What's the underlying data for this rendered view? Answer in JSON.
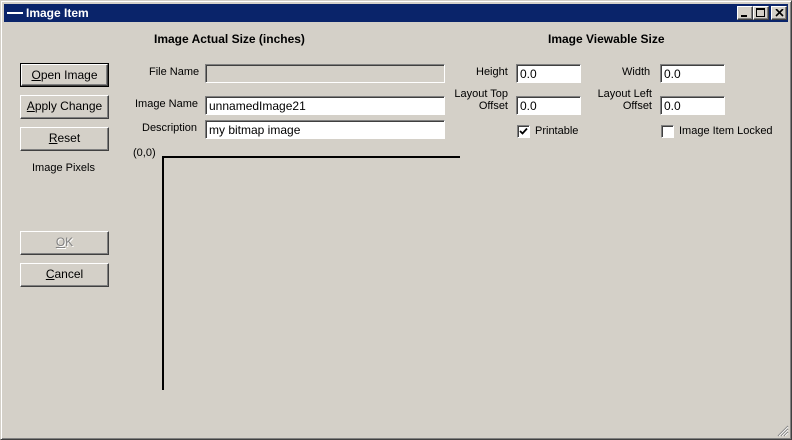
{
  "window": {
    "title": "Image Item",
    "controls": [
      "minimize-icon",
      "maximize-icon",
      "close-icon"
    ]
  },
  "actual_size": {
    "header": "Image Actual Size (inches)"
  },
  "viewable_size": {
    "header": "Image Viewable Size"
  },
  "buttons": {
    "open_image": {
      "underline": "O",
      "rest": "pen Image"
    },
    "apply_change": {
      "underline": "A",
      "rest": "pply Change"
    },
    "reset": {
      "underline": "R",
      "rest": "eset"
    },
    "ok": {
      "underline": "O",
      "rest": "K",
      "enabled": false
    },
    "cancel": {
      "underline": "C",
      "rest": "ancel"
    }
  },
  "image_pixels_label": "Image Pixels",
  "fields": {
    "file_name": {
      "label": "File Name",
      "value": "",
      "enabled": false
    },
    "image_name": {
      "label": "Image Name",
      "value": "unnamedImage21"
    },
    "description": {
      "label": "Description",
      "value": "my bitmap image"
    },
    "height": {
      "label": "Height",
      "value": "0.0"
    },
    "width": {
      "label": "Width",
      "value": "0.0"
    },
    "layout_top_offset": {
      "label_line1": "Layout Top",
      "label_line2": "Offset",
      "value": "0.0"
    },
    "layout_left_offset": {
      "label_line1": "Layout Left",
      "label_line2": "Offset",
      "value": "0.0"
    }
  },
  "checkboxes": {
    "printable": {
      "label": "Printable",
      "checked": true
    },
    "locked": {
      "label": "Image Item Locked",
      "checked": false
    }
  },
  "preview": {
    "origin_label": "(0,0)"
  }
}
